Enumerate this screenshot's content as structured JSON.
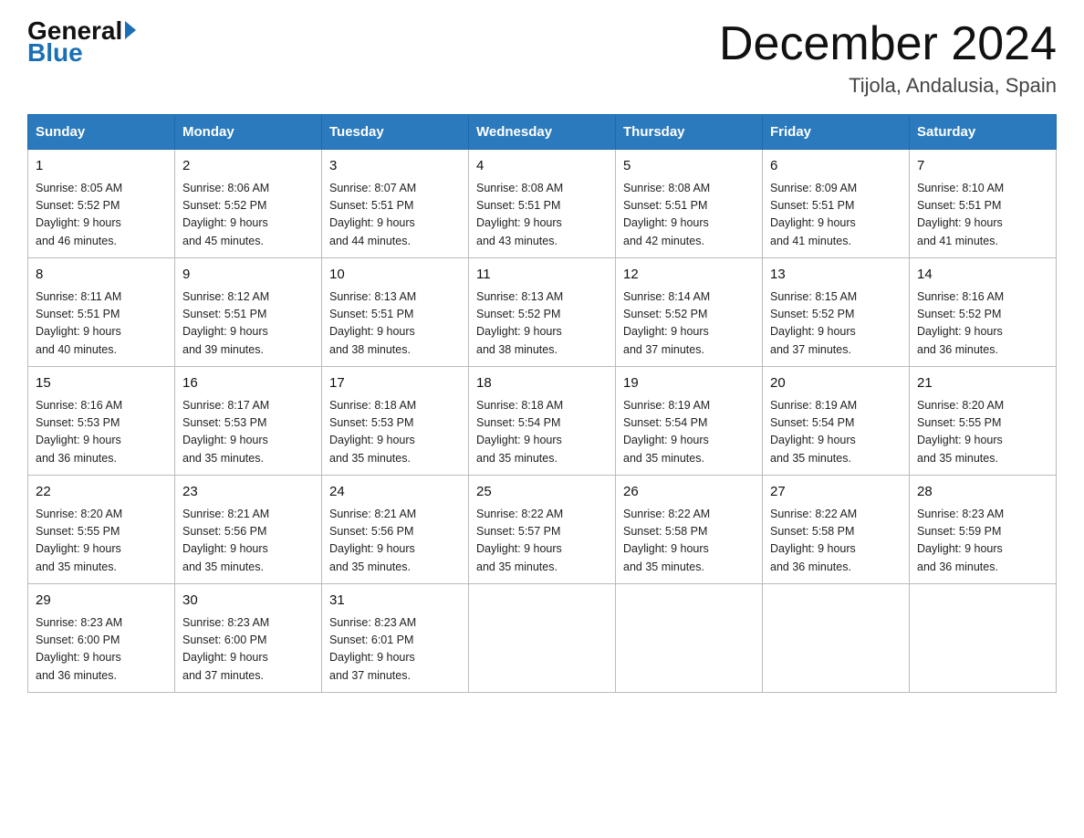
{
  "header": {
    "logo_general": "General",
    "logo_blue": "Blue",
    "title": "December 2024",
    "location": "Tijola, Andalusia, Spain"
  },
  "weekdays": [
    "Sunday",
    "Monday",
    "Tuesday",
    "Wednesday",
    "Thursday",
    "Friday",
    "Saturday"
  ],
  "weeks": [
    [
      {
        "day": "1",
        "sunrise": "8:05 AM",
        "sunset": "5:52 PM",
        "daylight": "9 hours and 46 minutes."
      },
      {
        "day": "2",
        "sunrise": "8:06 AM",
        "sunset": "5:52 PM",
        "daylight": "9 hours and 45 minutes."
      },
      {
        "day": "3",
        "sunrise": "8:07 AM",
        "sunset": "5:51 PM",
        "daylight": "9 hours and 44 minutes."
      },
      {
        "day": "4",
        "sunrise": "8:08 AM",
        "sunset": "5:51 PM",
        "daylight": "9 hours and 43 minutes."
      },
      {
        "day": "5",
        "sunrise": "8:08 AM",
        "sunset": "5:51 PM",
        "daylight": "9 hours and 42 minutes."
      },
      {
        "day": "6",
        "sunrise": "8:09 AM",
        "sunset": "5:51 PM",
        "daylight": "9 hours and 41 minutes."
      },
      {
        "day": "7",
        "sunrise": "8:10 AM",
        "sunset": "5:51 PM",
        "daylight": "9 hours and 41 minutes."
      }
    ],
    [
      {
        "day": "8",
        "sunrise": "8:11 AM",
        "sunset": "5:51 PM",
        "daylight": "9 hours and 40 minutes."
      },
      {
        "day": "9",
        "sunrise": "8:12 AM",
        "sunset": "5:51 PM",
        "daylight": "9 hours and 39 minutes."
      },
      {
        "day": "10",
        "sunrise": "8:13 AM",
        "sunset": "5:51 PM",
        "daylight": "9 hours and 38 minutes."
      },
      {
        "day": "11",
        "sunrise": "8:13 AM",
        "sunset": "5:52 PM",
        "daylight": "9 hours and 38 minutes."
      },
      {
        "day": "12",
        "sunrise": "8:14 AM",
        "sunset": "5:52 PM",
        "daylight": "9 hours and 37 minutes."
      },
      {
        "day": "13",
        "sunrise": "8:15 AM",
        "sunset": "5:52 PM",
        "daylight": "9 hours and 37 minutes."
      },
      {
        "day": "14",
        "sunrise": "8:16 AM",
        "sunset": "5:52 PM",
        "daylight": "9 hours and 36 minutes."
      }
    ],
    [
      {
        "day": "15",
        "sunrise": "8:16 AM",
        "sunset": "5:53 PM",
        "daylight": "9 hours and 36 minutes."
      },
      {
        "day": "16",
        "sunrise": "8:17 AM",
        "sunset": "5:53 PM",
        "daylight": "9 hours and 35 minutes."
      },
      {
        "day": "17",
        "sunrise": "8:18 AM",
        "sunset": "5:53 PM",
        "daylight": "9 hours and 35 minutes."
      },
      {
        "day": "18",
        "sunrise": "8:18 AM",
        "sunset": "5:54 PM",
        "daylight": "9 hours and 35 minutes."
      },
      {
        "day": "19",
        "sunrise": "8:19 AM",
        "sunset": "5:54 PM",
        "daylight": "9 hours and 35 minutes."
      },
      {
        "day": "20",
        "sunrise": "8:19 AM",
        "sunset": "5:54 PM",
        "daylight": "9 hours and 35 minutes."
      },
      {
        "day": "21",
        "sunrise": "8:20 AM",
        "sunset": "5:55 PM",
        "daylight": "9 hours and 35 minutes."
      }
    ],
    [
      {
        "day": "22",
        "sunrise": "8:20 AM",
        "sunset": "5:55 PM",
        "daylight": "9 hours and 35 minutes."
      },
      {
        "day": "23",
        "sunrise": "8:21 AM",
        "sunset": "5:56 PM",
        "daylight": "9 hours and 35 minutes."
      },
      {
        "day": "24",
        "sunrise": "8:21 AM",
        "sunset": "5:56 PM",
        "daylight": "9 hours and 35 minutes."
      },
      {
        "day": "25",
        "sunrise": "8:22 AM",
        "sunset": "5:57 PM",
        "daylight": "9 hours and 35 minutes."
      },
      {
        "day": "26",
        "sunrise": "8:22 AM",
        "sunset": "5:58 PM",
        "daylight": "9 hours and 35 minutes."
      },
      {
        "day": "27",
        "sunrise": "8:22 AM",
        "sunset": "5:58 PM",
        "daylight": "9 hours and 36 minutes."
      },
      {
        "day": "28",
        "sunrise": "8:23 AM",
        "sunset": "5:59 PM",
        "daylight": "9 hours and 36 minutes."
      }
    ],
    [
      {
        "day": "29",
        "sunrise": "8:23 AM",
        "sunset": "6:00 PM",
        "daylight": "9 hours and 36 minutes."
      },
      {
        "day": "30",
        "sunrise": "8:23 AM",
        "sunset": "6:00 PM",
        "daylight": "9 hours and 37 minutes."
      },
      {
        "day": "31",
        "sunrise": "8:23 AM",
        "sunset": "6:01 PM",
        "daylight": "9 hours and 37 minutes."
      },
      null,
      null,
      null,
      null
    ]
  ],
  "labels": {
    "sunrise": "Sunrise:",
    "sunset": "Sunset:",
    "daylight": "Daylight:"
  }
}
